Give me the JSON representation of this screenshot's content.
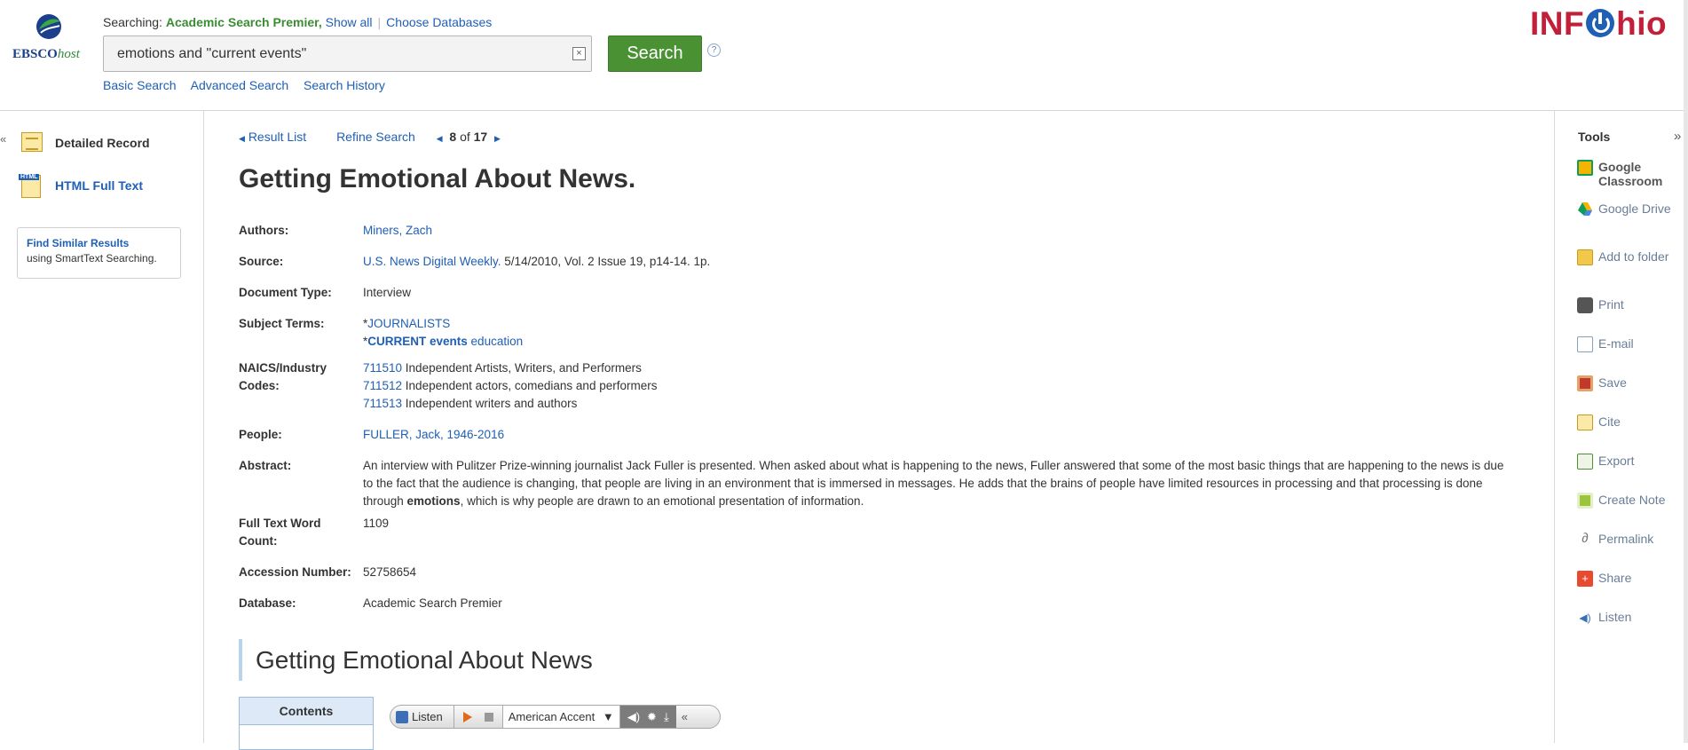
{
  "header": {
    "brand_main": "EBSCO",
    "brand_suffix": "host",
    "searching_label": "Searching:",
    "database": "Academic Search Premier,",
    "show_all": "Show all",
    "choose_databases": "Choose Databases",
    "query": "emotions and \"current events\"",
    "search_button": "Search",
    "help": "?",
    "clear": "×",
    "links": [
      "Basic Search",
      "Advanced Search",
      "Search History"
    ],
    "partner_pre": "INF",
    "partner_post": "hio"
  },
  "left_nav": {
    "collapse": "«",
    "items": [
      {
        "label": "Detailed Record",
        "icon": "detailed-record-icon"
      },
      {
        "label": "HTML Full Text",
        "icon": "html-full-text-icon"
      }
    ],
    "find_similar_title": "Find Similar Results",
    "find_similar_sub": "using SmartText Searching."
  },
  "record_nav": {
    "result_list": "Result List",
    "refine_search": "Refine Search",
    "current": "8",
    "of": "of",
    "total": "17"
  },
  "record": {
    "title": "Getting Emotional About News.",
    "labels": {
      "authors": "Authors:",
      "source": "Source:",
      "doctype": "Document Type:",
      "subjects": "Subject Terms:",
      "naics": "NAICS/Industry Codes:",
      "people": "People:",
      "abstract": "Abstract:",
      "wordcount": "Full Text Word Count:",
      "accession": "Accession Number:",
      "database": "Database:"
    },
    "authors": "Miners, Zach",
    "source_title": "U.S. News Digital Weekly.",
    "source_rest": " 5/14/2010, Vol. 2 Issue 19, p14-14. 1p.",
    "doctype": "Interview",
    "subject_1": "JOURNALISTS",
    "subject_2_bold": "CURRENT events",
    "subject_2_rest": " education",
    "naics": [
      {
        "code": "711510",
        "desc": " Independent Artists, Writers, and Performers"
      },
      {
        "code": "711512",
        "desc": " Independent actors, comedians and performers"
      },
      {
        "code": "711513",
        "desc": " Independent writers and authors"
      }
    ],
    "people": "FULLER, Jack, 1946-2016",
    "abstract_a": "An interview with Pulitzer Prize-winning journalist Jack Fuller is presented. When asked about what is happening to the news, Fuller answered that some of the most basic things that are happening to the news is due to the fact that the audience is changing, that people are living in an environment that is immersed in messages. He adds that the brains of people have limited resources in processing and that processing is done through ",
    "abstract_bold": "emotions",
    "abstract_b": ", which is why people are drawn to an emotional presentation of information.",
    "wordcount": "1109",
    "accession": "52758654",
    "database": "Academic Search Premier"
  },
  "fulltext": {
    "heading": "Getting Emotional About News",
    "contents": "Contents",
    "listen": "Listen",
    "accent": "American Accent"
  },
  "tools": {
    "title": "Tools",
    "collapse": "»",
    "items": [
      {
        "label": "Google Classroom",
        "icon": "google-classroom-icon",
        "color": "#f4b400"
      },
      {
        "label": "Google Drive",
        "icon": "google-drive-icon",
        "color": "#34a853"
      },
      {
        "label": "Add to folder",
        "icon": "folder-icon",
        "color": "#f2c84b"
      },
      {
        "label": "Print",
        "icon": "print-icon",
        "color": "#555555"
      },
      {
        "label": "E-mail",
        "icon": "email-icon",
        "color": "#8aa0b8"
      },
      {
        "label": "Save",
        "icon": "save-icon",
        "color": "#c0392b"
      },
      {
        "label": "Cite",
        "icon": "cite-icon",
        "color": "#f2c84b"
      },
      {
        "label": "Export",
        "icon": "export-icon",
        "color": "#4a9134"
      },
      {
        "label": "Create Note",
        "icon": "note-icon",
        "color": "#9bc53d"
      },
      {
        "label": "Permalink",
        "icon": "permalink-icon",
        "color": "#777777"
      },
      {
        "label": "Share",
        "icon": "share-icon",
        "color": "#e8492f"
      },
      {
        "label": "Listen",
        "icon": "listen-icon",
        "color": "#3c6fb5"
      }
    ]
  }
}
